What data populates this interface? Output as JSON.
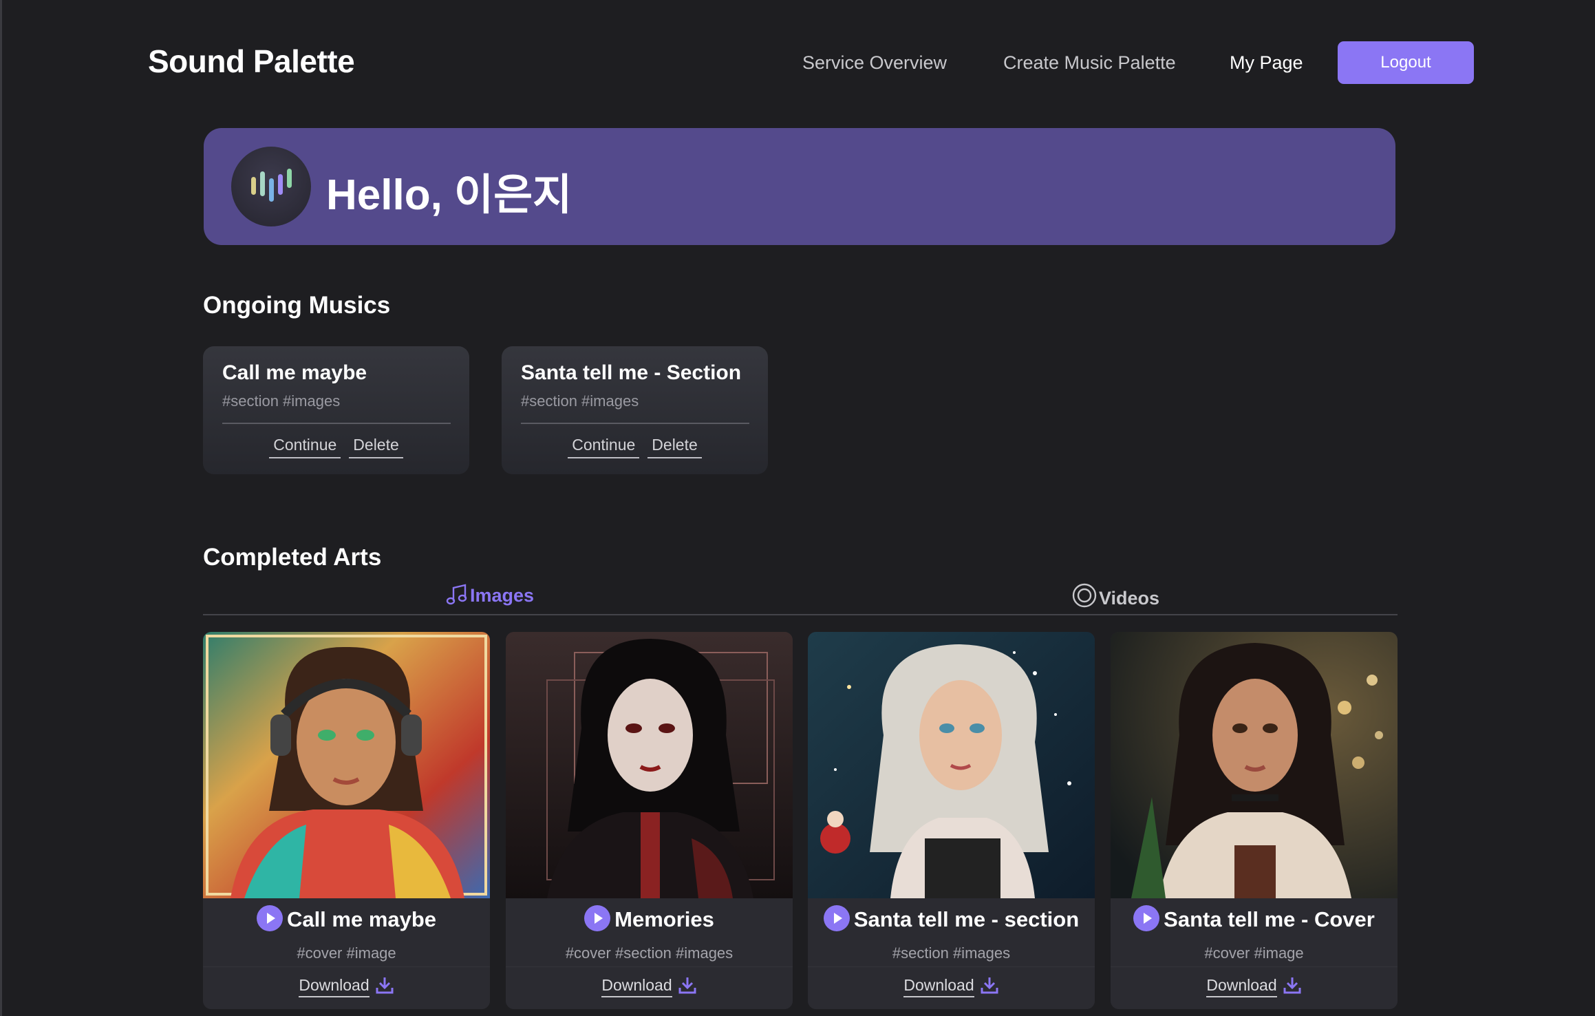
{
  "header": {
    "logo": "Sound Palette",
    "nav": [
      {
        "label": "Service Overview"
      },
      {
        "label": "Create Music Palette"
      },
      {
        "label": "My Page"
      }
    ],
    "logout_label": "Logout"
  },
  "greeting": {
    "text": "Hello, 이은지"
  },
  "ongoing": {
    "title": "Ongoing Musics",
    "cards": [
      {
        "title": "Call me maybe",
        "tags": "#section #images",
        "continue_label": "Continue",
        "delete_label": "Delete"
      },
      {
        "title": "Santa tell me - Section",
        "tags": "#section #images",
        "continue_label": "Continue",
        "delete_label": "Delete"
      }
    ]
  },
  "completed": {
    "title": "Completed Arts",
    "tabs": [
      {
        "label": "Images",
        "icon": "music-note-icon",
        "active": true
      },
      {
        "label": "Videos",
        "icon": "video-circle-icon",
        "active": false
      }
    ],
    "arts": [
      {
        "title": "Call me maybe",
        "tags": "#cover #image",
        "download_label": "Download"
      },
      {
        "title": "Memories",
        "tags": "#cover #section #images",
        "download_label": "Download"
      },
      {
        "title": "Santa tell me - section",
        "tags": "#section #images",
        "download_label": "Download"
      },
      {
        "title": "Santa tell me - Cover",
        "tags": "#cover #image",
        "download_label": "Download"
      }
    ]
  },
  "colors": {
    "background": "#1e1e21",
    "accent": "#8b76f4",
    "banner": "#544a8c",
    "card": "#2a2a30"
  }
}
